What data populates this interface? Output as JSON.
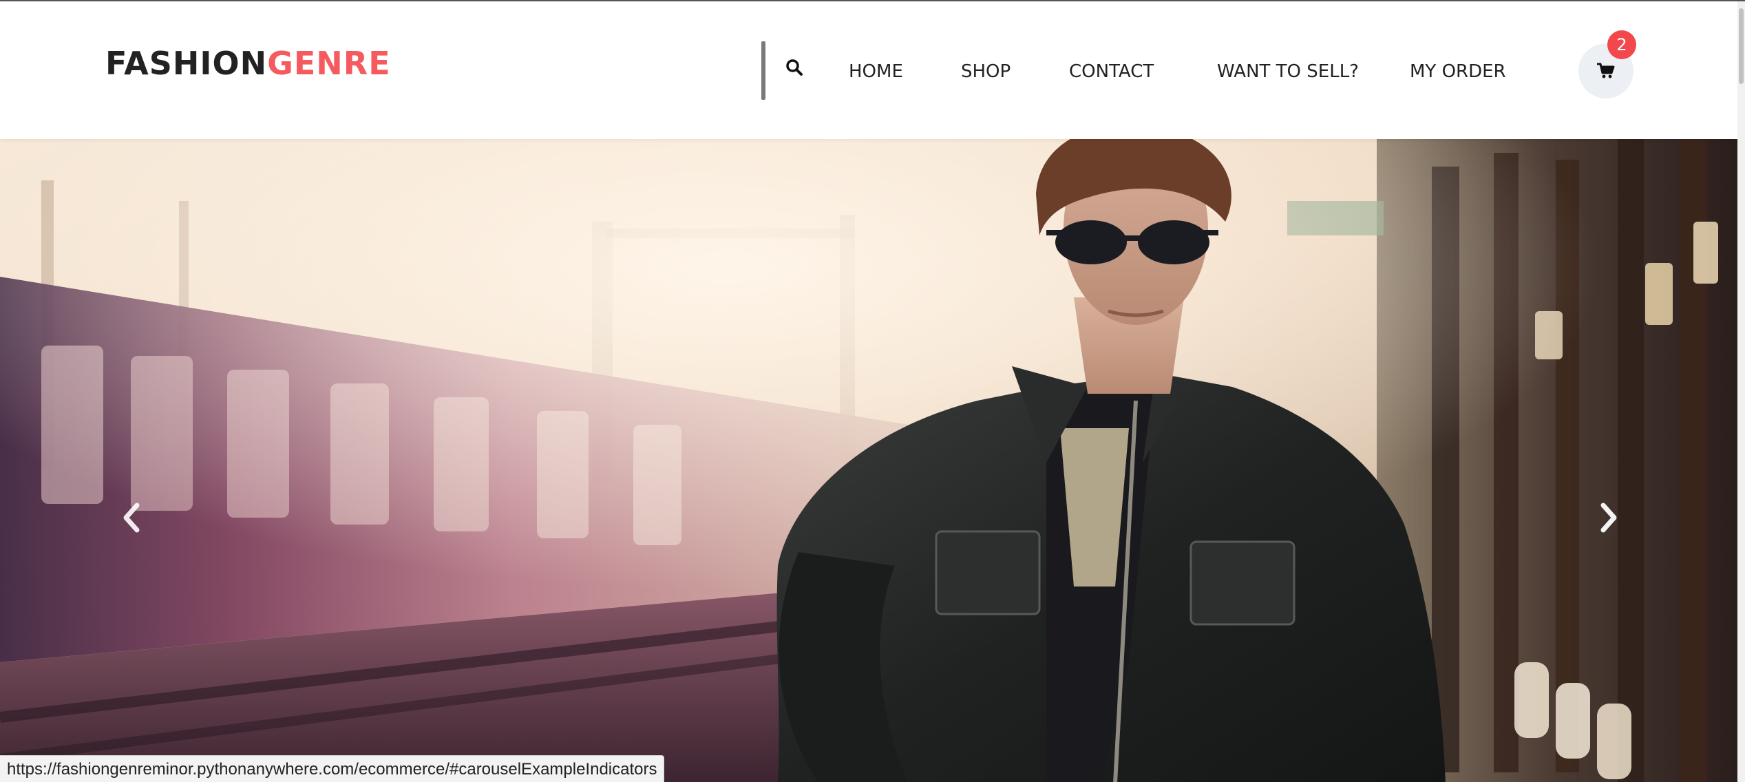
{
  "brand": {
    "name_part1": "FASHION",
    "name_part2": "GENRE",
    "accent_color": "#f55a5f"
  },
  "header": {
    "search_icon": "search-icon",
    "nav_items": [
      {
        "label": "HOME"
      },
      {
        "label": "SHOP"
      },
      {
        "label": "CONTACT"
      },
      {
        "label": "WANT TO SELL?"
      },
      {
        "label": "MY ORDER"
      }
    ],
    "cart": {
      "icon": "shopping-cart-icon",
      "count": "2",
      "badge_color": "#f2484c"
    }
  },
  "carousel": {
    "prev_icon": "chevron-left-icon",
    "next_icon": "chevron-right-icon"
  },
  "status_bar": {
    "url": "https://fashiongenreminor.pythonanywhere.com/ecommerce/#carouselExampleIndicators"
  }
}
